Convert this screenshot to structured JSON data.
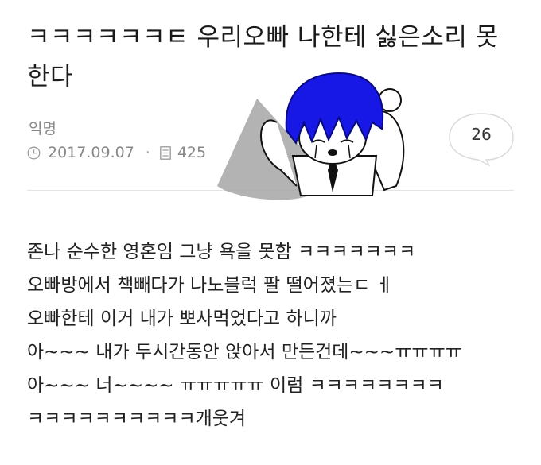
{
  "post": {
    "title": "ㅋㅋㅋㅋㅋㅋㅌ 우리오빠 나한테 싫은소리 못한다",
    "author": "익명",
    "date": "2017.09.07",
    "views": "425",
    "comment_count": "26",
    "body_lines": [
      "존나 순수한 영혼임 그냥 욕을 못함 ㅋㅋㅋㅋㅋㅋㅋ",
      "오빠방에서 책빼다가 나노블럭 팔 떨어졌는ㄷ ㅔ",
      "오빠한테 이거 내가 뽀사먹었다고 하니까",
      "아~~~ 내가 두시간동안 앉아서 만든건데~~~ㅠㅠㅠㅠ",
      "아~~~ 너~~~~ ㅠㅠㅠㅠㅠ 이럼 ㅋㅋㅋㅋㅋㅋㅋㅋ",
      "ㅋㅋㅋㅋㅋㅋㅋㅋㅋㅋ개웃겨"
    ]
  },
  "icons": {
    "date": "clock-icon",
    "views": "document-icon",
    "comments": "speech-bubble-icon",
    "overlay": "anime-character-sticker"
  },
  "colors": {
    "text": "#222222",
    "meta": "#888888",
    "divider": "#e4e4e4",
    "sticker_hair": "#1717e6"
  }
}
